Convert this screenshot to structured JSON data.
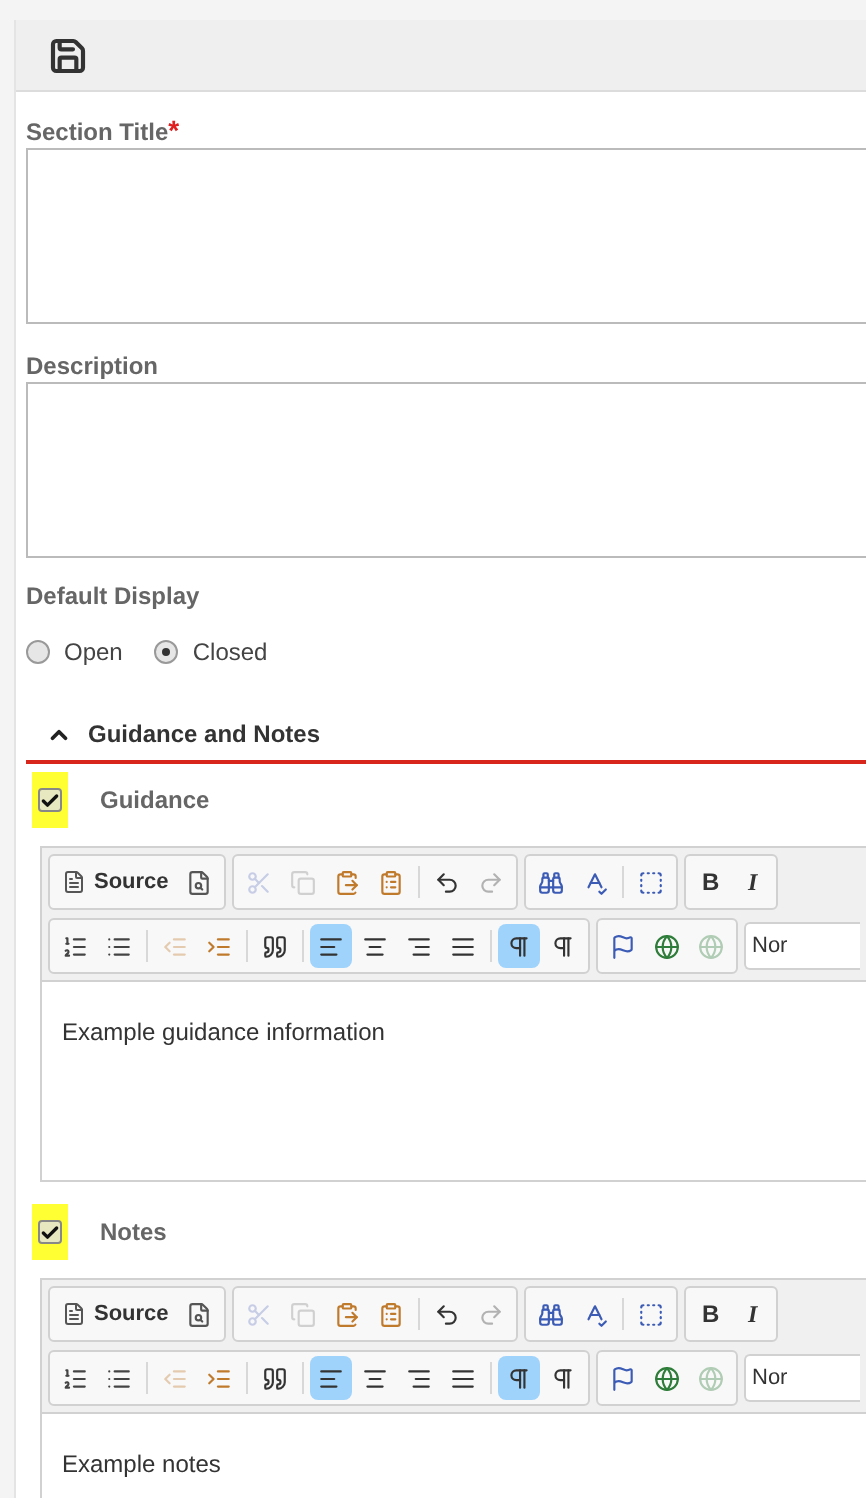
{
  "form": {
    "fields": [
      {
        "label": "Section Title",
        "required_mark": "*"
      },
      {
        "label": "Description"
      }
    ],
    "default_display": {
      "label": "Default Display",
      "options": [
        {
          "label": "Open",
          "selected": false
        },
        {
          "label": "Closed",
          "selected": true
        }
      ]
    }
  },
  "guidance_section": {
    "title": "Guidance and Notes",
    "expanded": true,
    "editors": [
      {
        "label": "Guidance",
        "checked": true,
        "highlighted": true,
        "content": "Example guidance information",
        "source_label": "Source",
        "bold_label": "B",
        "italic_label": "I",
        "format_value": "Nor",
        "buttons": [
          {
            "selected": false,
            "disabled": false
          },
          {
            "selected": false,
            "disabled": false
          },
          {
            "selected": false,
            "disabled": true
          },
          {
            "selected": false,
            "disabled": true
          },
          {
            "selected": false,
            "disabled": false
          },
          {
            "selected": false,
            "disabled": false
          },
          {
            "selected": false,
            "disabled": false
          },
          {
            "selected": false,
            "disabled": true
          },
          {
            "selected": false,
            "disabled": false
          },
          {
            "selected": false,
            "disabled": false
          },
          {
            "selected": false,
            "disabled": false
          },
          {
            "selected": false,
            "disabled": false
          },
          {
            "selected": false,
            "disabled": false
          },
          {
            "selected": false,
            "disabled": false
          },
          {
            "selected": false,
            "disabled": false
          },
          {
            "selected": false,
            "disabled": true
          },
          {
            "selected": false,
            "disabled": false
          },
          {
            "selected": false,
            "disabled": false
          },
          {
            "selected": true,
            "disabled": false
          },
          {
            "selected": false,
            "disabled": false
          },
          {
            "selected": false,
            "disabled": false
          },
          {
            "selected": false,
            "disabled": false
          },
          {
            "selected": true,
            "disabled": false
          },
          {
            "selected": false,
            "disabled": false
          },
          {
            "selected": false,
            "disabled": false
          },
          {
            "selected": false,
            "disabled": false
          },
          {
            "selected": false,
            "disabled": true
          }
        ]
      },
      {
        "label": "Notes",
        "checked": true,
        "highlighted": true,
        "content": "Example notes",
        "source_label": "Source",
        "bold_label": "B",
        "italic_label": "I",
        "format_value": "Nor",
        "buttons": [
          {
            "selected": false,
            "disabled": false
          },
          {
            "selected": false,
            "disabled": false
          },
          {
            "selected": false,
            "disabled": true
          },
          {
            "selected": false,
            "disabled": true
          },
          {
            "selected": false,
            "disabled": false
          },
          {
            "selected": false,
            "disabled": false
          },
          {
            "selected": false,
            "disabled": false
          },
          {
            "selected": false,
            "disabled": true
          },
          {
            "selected": false,
            "disabled": false
          },
          {
            "selected": false,
            "disabled": false
          },
          {
            "selected": false,
            "disabled": false
          },
          {
            "selected": false,
            "disabled": false
          },
          {
            "selected": false,
            "disabled": false
          },
          {
            "selected": false,
            "disabled": false
          },
          {
            "selected": false,
            "disabled": false
          },
          {
            "selected": false,
            "disabled": true
          },
          {
            "selected": false,
            "disabled": false
          },
          {
            "selected": false,
            "disabled": false
          },
          {
            "selected": true,
            "disabled": false
          },
          {
            "selected": false,
            "disabled": false
          },
          {
            "selected": false,
            "disabled": false
          },
          {
            "selected": false,
            "disabled": false
          },
          {
            "selected": true,
            "disabled": false
          },
          {
            "selected": false,
            "disabled": false
          },
          {
            "selected": false,
            "disabled": false
          },
          {
            "selected": false,
            "disabled": false
          },
          {
            "selected": false,
            "disabled": true
          }
        ]
      }
    ]
  }
}
